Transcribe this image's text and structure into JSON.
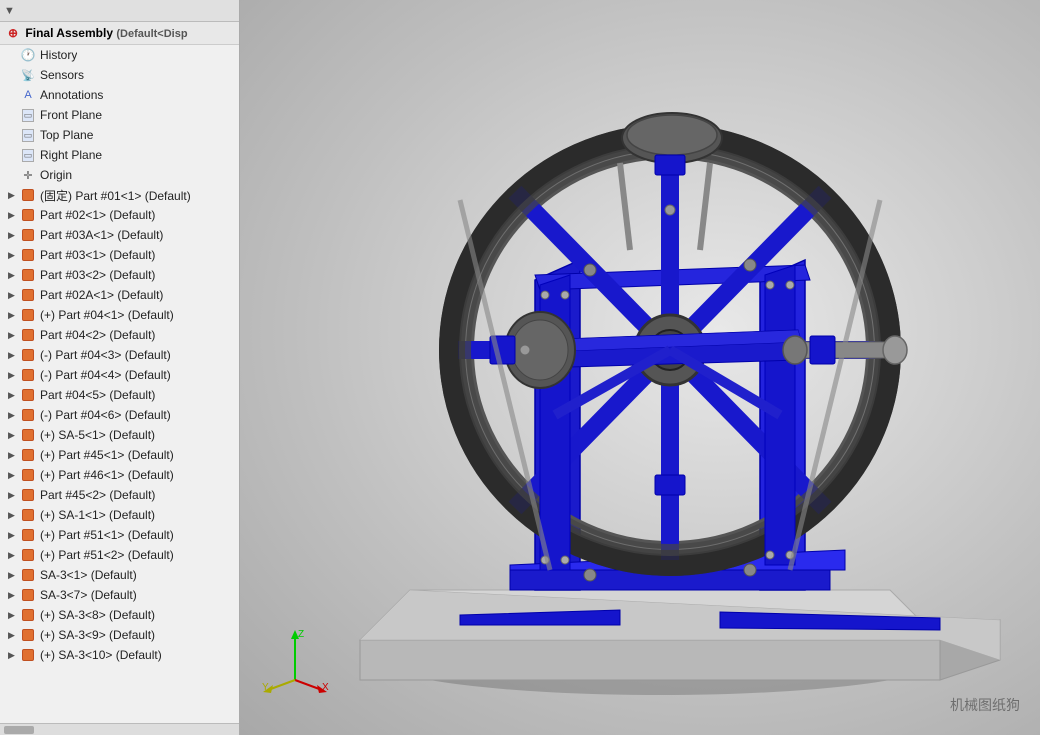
{
  "header": {
    "assembly_name": "Final Assembly",
    "assembly_config": "(Default<Disp",
    "filter_icon": "▼"
  },
  "tree": {
    "items": [
      {
        "id": "history",
        "label": "History",
        "icon": "history",
        "level": 1,
        "expandable": false
      },
      {
        "id": "sensors",
        "label": "Sensors",
        "icon": "sensor",
        "level": 1,
        "expandable": false
      },
      {
        "id": "annotations",
        "label": "Annotations",
        "icon": "annotation",
        "level": 1,
        "expandable": false
      },
      {
        "id": "front-plane",
        "label": "Front Plane",
        "icon": "plane",
        "level": 1,
        "expandable": false
      },
      {
        "id": "top-plane",
        "label": "Top Plane",
        "icon": "plane",
        "level": 1,
        "expandable": false
      },
      {
        "id": "right-plane",
        "label": "Right Plane",
        "icon": "plane",
        "level": 1,
        "expandable": false
      },
      {
        "id": "origin",
        "label": "Origin",
        "icon": "origin",
        "level": 1,
        "expandable": false
      },
      {
        "id": "part01",
        "label": "(固定) Part #01<1> (Default)",
        "icon": "part-orange",
        "level": 1,
        "expandable": true
      },
      {
        "id": "part02",
        "label": "Part #02<1> (Default)",
        "icon": "part-orange",
        "level": 1,
        "expandable": true
      },
      {
        "id": "part03a",
        "label": "Part #03A<1> (Default)",
        "icon": "part-orange",
        "level": 1,
        "expandable": true
      },
      {
        "id": "part03-1",
        "label": "Part #03<1> (Default)",
        "icon": "part-orange",
        "level": 1,
        "expandable": true
      },
      {
        "id": "part03-2",
        "label": "Part #03<2> (Default)",
        "icon": "part-orange",
        "level": 1,
        "expandable": true
      },
      {
        "id": "part02a",
        "label": "Part #02A<1> (Default)",
        "icon": "part-orange",
        "level": 1,
        "expandable": true
      },
      {
        "id": "part04-1",
        "label": "(+) Part #04<1> (Default)",
        "icon": "part-orange",
        "level": 1,
        "expandable": true
      },
      {
        "id": "part04-2",
        "label": "Part #04<2> (Default)",
        "icon": "part-orange",
        "level": 1,
        "expandable": true
      },
      {
        "id": "part04-3",
        "label": "(-) Part #04<3> (Default)",
        "icon": "part-orange",
        "level": 1,
        "expandable": true
      },
      {
        "id": "part04-4",
        "label": "(-) Part #04<4> (Default)",
        "icon": "part-orange",
        "level": 1,
        "expandable": true
      },
      {
        "id": "part04-5",
        "label": "Part #04<5> (Default)",
        "icon": "part-orange",
        "level": 1,
        "expandable": true
      },
      {
        "id": "part04-6",
        "label": "(-) Part #04<6> (Default)",
        "icon": "part-orange",
        "level": 1,
        "expandable": true
      },
      {
        "id": "sa5-1",
        "label": "(+) SA-5<1> (Default)",
        "icon": "part-orange",
        "level": 1,
        "expandable": true
      },
      {
        "id": "part45-1",
        "label": "(+) Part #45<1> (Default)",
        "icon": "part-orange",
        "level": 1,
        "expandable": true
      },
      {
        "id": "part46-1",
        "label": "(+) Part #46<1> (Default)",
        "icon": "part-orange",
        "level": 1,
        "expandable": true
      },
      {
        "id": "part45-2",
        "label": "Part #45<2> (Default)",
        "icon": "part-orange",
        "level": 1,
        "expandable": true
      },
      {
        "id": "sa1-1",
        "label": "(+) SA-1<1> (Default)",
        "icon": "part-orange",
        "level": 1,
        "expandable": true
      },
      {
        "id": "part51-1",
        "label": "(+) Part #51<1> (Default)",
        "icon": "part-orange",
        "level": 1,
        "expandable": true
      },
      {
        "id": "part51-2",
        "label": "(+) Part #51<2> (Default)",
        "icon": "part-orange",
        "level": 1,
        "expandable": true
      },
      {
        "id": "sa3-1",
        "label": "SA-3<1> (Default)",
        "icon": "part-orange",
        "level": 1,
        "expandable": true
      },
      {
        "id": "sa3-7",
        "label": "SA-3<7> (Default)",
        "icon": "part-orange",
        "level": 1,
        "expandable": true
      },
      {
        "id": "sa3-8",
        "label": "(+) SA-3<8> (Default)",
        "icon": "part-orange",
        "level": 1,
        "expandable": true
      },
      {
        "id": "sa3-9",
        "label": "(+) SA-3<9> (Default)",
        "icon": "part-orange",
        "level": 1,
        "expandable": true
      },
      {
        "id": "sa3-10",
        "label": "(+) SA-3<10> (Default)",
        "icon": "part-orange",
        "level": 1,
        "expandable": true
      }
    ]
  },
  "watermark": "机械图纸狗",
  "axis": {
    "x_label": "X",
    "y_label": "Y",
    "z_label": "Z"
  }
}
